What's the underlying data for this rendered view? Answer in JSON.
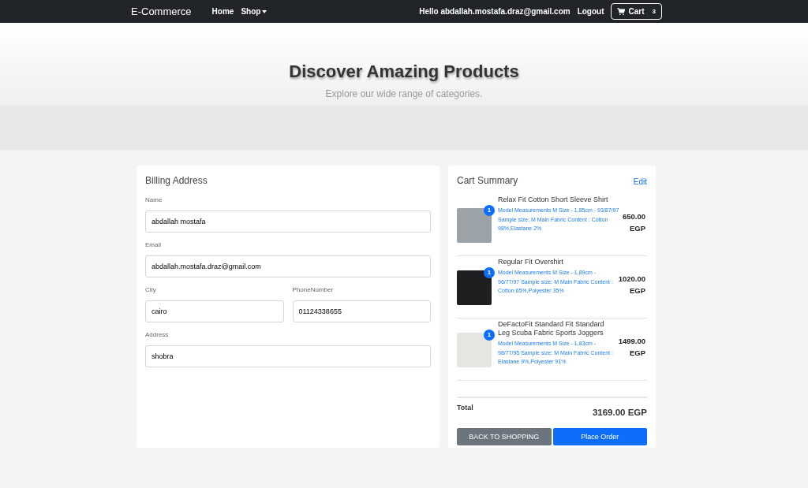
{
  "navbar": {
    "brand": "E-Commerce",
    "links": [
      {
        "label": "Home",
        "dropdown": false
      },
      {
        "label": "Shop",
        "dropdown": true
      }
    ],
    "greeting": "Hello abdallah.mostafa.draz@gmail.com",
    "logout": "Logout",
    "cart": {
      "label": "Cart",
      "count": "3"
    }
  },
  "hero": {
    "title": "Discover Amazing Products",
    "subtitle": "Explore our wide range of categories."
  },
  "billing": {
    "title": "Billing Address",
    "rows": [
      [
        {
          "label": "Name",
          "value": "abdallah mostafa"
        }
      ],
      [
        {
          "label": "Email",
          "value": "abdallah.mostafa.draz@gmail.com"
        }
      ],
      [
        {
          "label": "City",
          "value": "cairo"
        },
        {
          "label": "PhoneNumber",
          "value": "01124338655"
        }
      ],
      [
        {
          "label": "Address",
          "value": "shobra"
        }
      ]
    ]
  },
  "cart_summary": {
    "title": "Cart Summary",
    "edit": "Edit",
    "items": [
      {
        "name": "Relax Fit Cotton Short Sleeve Shirt",
        "quantity": "1",
        "description": "Model Measurements M Size - 1,85cm - 93/87/97 Sample size: M Main Fabric Content : Cotton 98%,Elastane 2%",
        "price": "650.00 EGP",
        "color": "#9ca3a8"
      },
      {
        "name": "Regular Fit Overshirt",
        "quantity": "1",
        "description": "Model Measurements M Size - 1,89cm - 96/77/97 Sample size: M Main Fabric Content : Cotton 65%,Polyester 35%",
        "price": "1020.00 EGP",
        "color": "#1f1f22"
      },
      {
        "name": "DeFactoFit Standard Fit Standard Leg Scuba Fabric Sports Joggers",
        "quantity": "1",
        "description": "Model Measurements M Size - 1,83cm - 98/77/95 Sample size: M Main Fabric Content : Elastane 9%,Polyester 91%",
        "price": "1499.00 EGP",
        "color": "#e5e5e2"
      }
    ],
    "total_label": "Total",
    "total": "3169.00 EGP",
    "back_button": "BACK TO SHOPPING",
    "order_button": "Place Order"
  }
}
